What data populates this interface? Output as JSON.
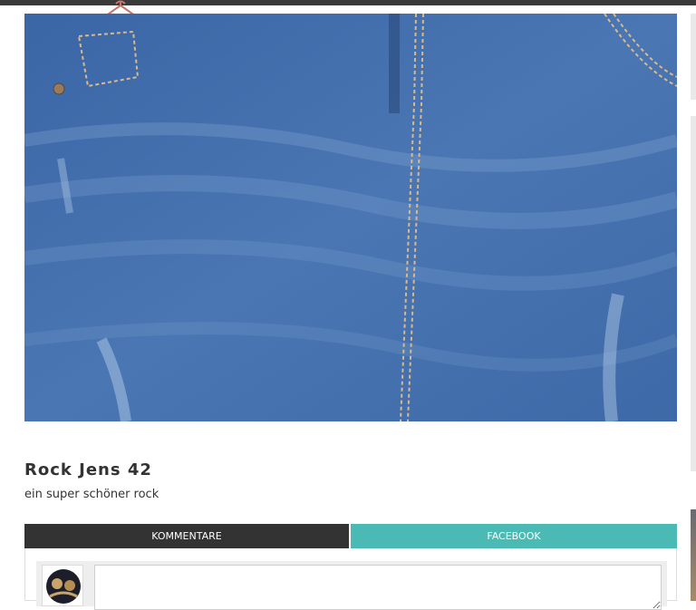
{
  "product": {
    "title": "Rock Jens 42",
    "description": "ein super schöner rock"
  },
  "tabs": {
    "comments_label": "KOMMENTARE",
    "facebook_label": "FACEBOOK"
  },
  "comment_form": {
    "input_value": "",
    "placeholder": ""
  },
  "colors": {
    "topbar": "#3a3a3a",
    "comments_tab": "#333333",
    "facebook_tab": "#4bbab4",
    "denim": "#3f6aa8",
    "hanger_accent": "#c8746a"
  },
  "icons": {
    "top_icon": "hanger-icon"
  }
}
